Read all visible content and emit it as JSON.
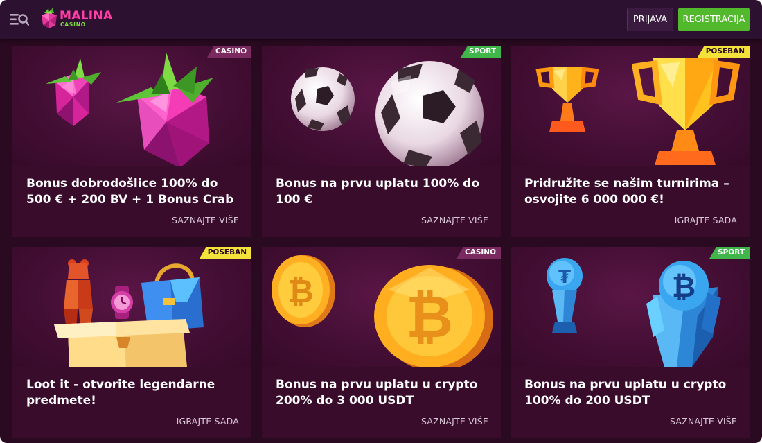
{
  "brand": {
    "name": "MALINA",
    "sub": "CASINO",
    "name_color": "#ff3fa6",
    "sub_color": "#7fdc3a"
  },
  "header": {
    "menu_icon": "menu-search-icon",
    "login_label": "PRIJAVA",
    "register_label": "REGISTRACIJA",
    "register_color": "#52b82c"
  },
  "cards": [
    {
      "badge": "CASINO",
      "badge_type": "casino",
      "title": "Bonus dobrodošlice 100% do 500 € + 200 BV + 1 Bonus Crab",
      "link": "SAZNAJTE VIŠE",
      "art": "raspberries"
    },
    {
      "badge": "SPORT",
      "badge_type": "sport",
      "title": "Bonus na prvu uplatu 100% do 100 €",
      "link": "SAZNAJTE VIŠE",
      "art": "soccer-balls"
    },
    {
      "badge": "POSEBAN",
      "badge_type": "special",
      "title": "Pridružite se našim turnirima – osvojite 6 000 000 €!",
      "link": "IGRAJTE SADA",
      "art": "trophies"
    },
    {
      "badge": "POSEBAN",
      "badge_type": "special",
      "title": "Loot it - otvorite legendarne predmete!",
      "link": "IGRAJTE SADA",
      "art": "loot-box"
    },
    {
      "badge": "CASINO",
      "badge_type": "casino",
      "title": "Bonus na prvu uplatu u crypto 200% do 3 000 USDT",
      "link": "SAZNAJTE VIŠE",
      "art": "bitcoin-coins"
    },
    {
      "badge": "SPORT",
      "badge_type": "sport",
      "title": "Bonus na prvu uplatu u crypto 100% do 200 USDT",
      "link": "SAZNAJTE VIŠE",
      "art": "crypto-trophies"
    }
  ]
}
